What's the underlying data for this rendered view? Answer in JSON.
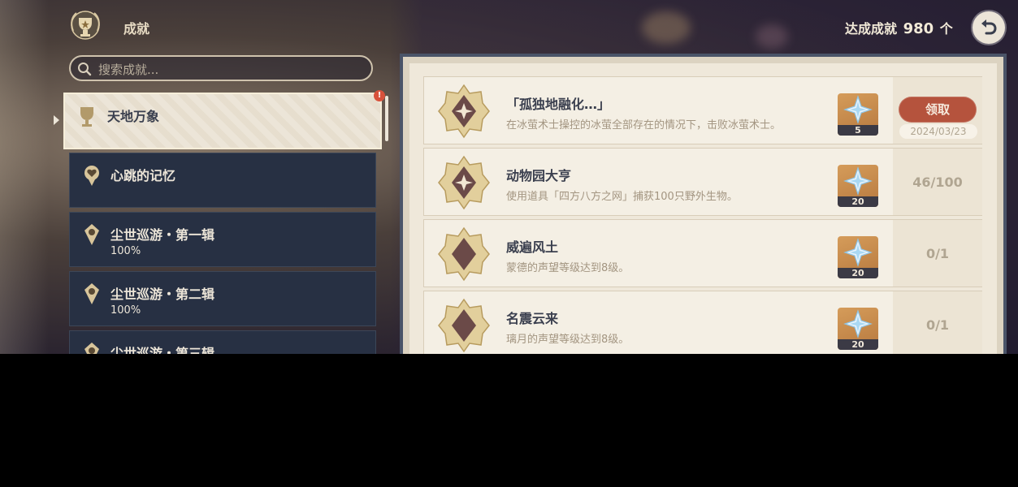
{
  "header": {
    "title": "成就",
    "count_label": "达成成就",
    "count_value": "980",
    "count_unit": "个"
  },
  "search": {
    "placeholder": "搜索成就..."
  },
  "categories": [
    {
      "name": "天地万象",
      "progress": "",
      "selected": true,
      "new_badge": "!"
    },
    {
      "name": "心跳的记忆",
      "progress": ""
    },
    {
      "name": "尘世巡游・第一辑",
      "progress": "100%"
    },
    {
      "name": "尘世巡游・第二辑",
      "progress": "100%"
    },
    {
      "name": "尘世巡游・第三辑",
      "progress": ""
    }
  ],
  "achievements": [
    {
      "title": "「孤独地融化…」",
      "description": "在冰萤术士操控的冰萤全部存在的情况下，击败冰萤术士。",
      "reward_qty": "5",
      "claim_label": "领取",
      "date": "2024/03/23"
    },
    {
      "title": "动物园大亨",
      "description": "使用道具「四方八方之网」捕获100只野外生物。",
      "reward_qty": "20",
      "status": "46/100"
    },
    {
      "title": "威遍风土",
      "description": "蒙德的声望等级达到8级。",
      "reward_qty": "20",
      "status": "0/1"
    },
    {
      "title": "名震云来",
      "description": "璃月的声望等级达到8级。",
      "reward_qty": "20",
      "status": "0/1"
    }
  ],
  "colors": {
    "accent_claim": "#b5533d",
    "panel_bg": "#efe8da",
    "category_bg": "#273043",
    "text_dark": "#3a3f4e"
  },
  "icons": {
    "header": "trophy-wreath-icon",
    "back": "return-arrow-icon",
    "search": "search-icon",
    "reward": "primogem-icon",
    "medal": "achievement-medal-icon"
  }
}
